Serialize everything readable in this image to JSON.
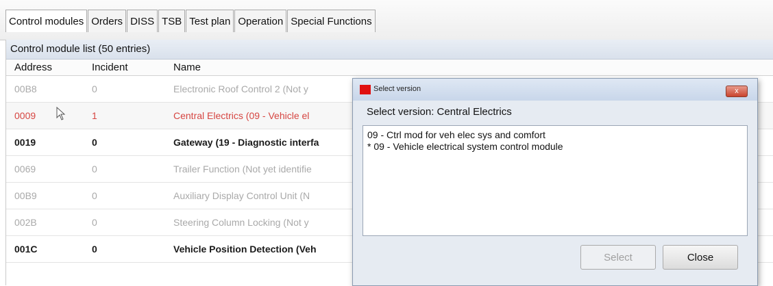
{
  "tabs": [
    {
      "label": "Control modules"
    },
    {
      "label": "Orders"
    },
    {
      "label": "DISS"
    },
    {
      "label": "TSB"
    },
    {
      "label": "Test plan"
    },
    {
      "label": "Operation"
    },
    {
      "label": "Special Functions"
    }
  ],
  "list": {
    "header": "Control module list (50 entries)",
    "columns": {
      "address": "Address",
      "incident": "Incident",
      "name": "Name"
    },
    "rows": [
      {
        "address": "00B8",
        "incident": "0",
        "name": "Electronic Roof Control 2 (Not y",
        "state": "disabled"
      },
      {
        "address": "0009",
        "incident": "1",
        "name": "Central Electrics (09 - Vehicle el",
        "state": "error"
      },
      {
        "address": "0019",
        "incident": "0",
        "name": "Gateway (19 - Diagnostic interfa",
        "state": "active"
      },
      {
        "address": "0069",
        "incident": "0",
        "name": "Trailer Function (Not yet identifie",
        "state": "disabled"
      },
      {
        "address": "00B9",
        "incident": "0",
        "name": "Auxiliary Display Control Unit (N",
        "state": "disabled"
      },
      {
        "address": "002B",
        "incident": "0",
        "name": "Steering Column Locking (Not y",
        "state": "disabled"
      },
      {
        "address": "001C",
        "incident": "0",
        "name": "Vehicle Position Detection (Veh",
        "state": "active"
      }
    ]
  },
  "dialog": {
    "title": "Select version",
    "heading": "Select version: Central Electrics",
    "items": [
      " 09 - Ctrl mod for veh elec sys and comfort",
      "* 09 - Vehicle electrical system control module"
    ],
    "select_label": "Select",
    "close_label": "Close",
    "close_glyph": "x"
  },
  "colors": {
    "error_row_text": "#d64541",
    "dialog_icon": "#e01010"
  }
}
